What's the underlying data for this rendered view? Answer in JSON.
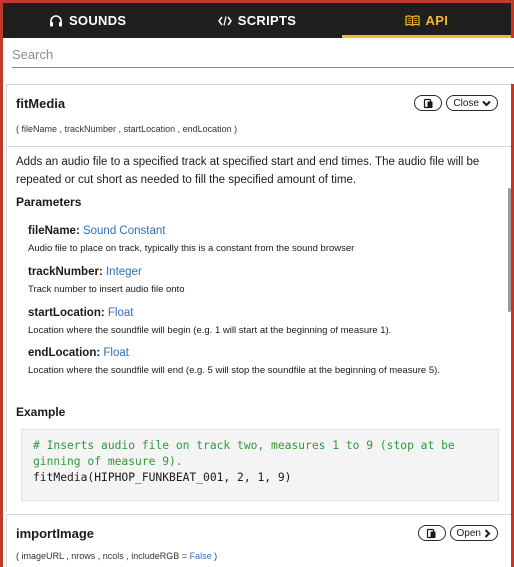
{
  "tabs": [
    {
      "label": "SOUNDS",
      "icon": "headphones-icon",
      "active": false
    },
    {
      "label": "SCRIPTS",
      "icon": "code-icon",
      "active": false
    },
    {
      "label": "API",
      "icon": "book-icon",
      "active": true
    }
  ],
  "search": {
    "placeholder": "Search",
    "value": ""
  },
  "functions": [
    {
      "name": "fitMedia",
      "signature_parts": [
        "fileName",
        "trackNumber",
        "startLocation",
        "endLocation"
      ],
      "toggle_label": "Close",
      "description": "Adds an audio file to a specified track at specified start and end times. The audio file will be repeated or cut short as needed to fill the specified amount of time.",
      "parameters_heading": "Parameters",
      "parameters": [
        {
          "name": "fileName",
          "type": "Sound Constant",
          "description": "Audio file to place on track, typically this is a constant from the sound browser"
        },
        {
          "name": "trackNumber",
          "type": "Integer",
          "description": "Track number to insert audio file onto"
        },
        {
          "name": "startLocation",
          "type": "Float",
          "description": "Location where the soundfile will begin (e.g. 1 will start at the beginning of measure 1)."
        },
        {
          "name": "endLocation",
          "type": "Float",
          "description": "Location where the soundfile will end (e.g. 5 will stop the soundfile at the beginning of measure 5)."
        }
      ],
      "example_heading": "Example",
      "example_comment_line1": "# Inserts audio file on track two, measures 1 to 9 (stop at be",
      "example_comment_line2": "ginning of measure 9).",
      "example_code": "fitMedia(HIPHOP_FUNKBEAT_001, 2, 1, 9)"
    },
    {
      "name": "importImage",
      "signature_parts": [
        "imageURL",
        "nrows",
        "ncols",
        "includeRGB"
      ],
      "signature_default": "False",
      "toggle_label": "Open"
    }
  ],
  "colors": {
    "accent": "#f5b731",
    "tabbar_bg": "#1f1f1f",
    "frame": "#c0392b",
    "type_link": "#2f6fb6",
    "code_comment": "#2e9a3c"
  }
}
